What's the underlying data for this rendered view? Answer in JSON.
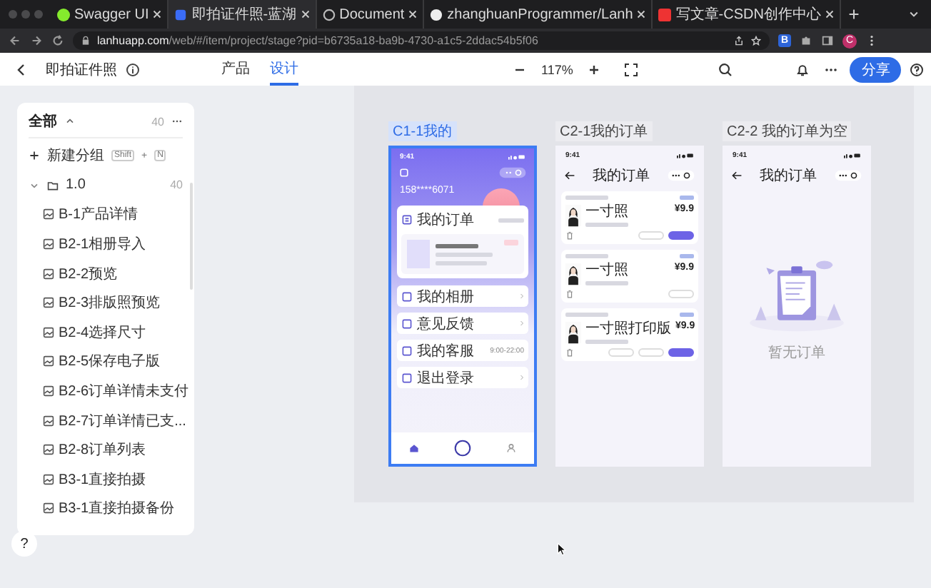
{
  "browser": {
    "tabs": [
      {
        "title": "Swagger UI",
        "selected": false,
        "kind": "swagger"
      },
      {
        "title": "即拍证件照-蓝湖",
        "selected": true,
        "kind": "lanhu"
      },
      {
        "title": "Document",
        "selected": false,
        "kind": "globe"
      },
      {
        "title": "zhanghuanProgrammer/Lanh",
        "selected": false,
        "kind": "github"
      },
      {
        "title": "写文章-CSDN创作中心",
        "selected": false,
        "kind": "csdn"
      }
    ],
    "url_host": "lanhuapp.com",
    "url_path": "/web/#/item/project/stage?pid=b6735a18-ba9b-4730-a1c5-2ddac54b5f06",
    "extension": "B",
    "profile": "C"
  },
  "header": {
    "project": "即拍证件照",
    "tabs": [
      {
        "label": "产品",
        "selected": false
      },
      {
        "label": "设计",
        "selected": true
      }
    ],
    "zoom": "117%",
    "share": "分享"
  },
  "sidebar": {
    "title": "全部",
    "count": "40",
    "new_group": "新建分组",
    "shortcut": [
      "Shift",
      "+",
      "N"
    ],
    "help": "?",
    "folders": [
      {
        "name": "1.0",
        "count": "40",
        "expanded": true,
        "children": [
          {
            "name": "B-1产品详情"
          },
          {
            "name": "B2-1相册导入"
          },
          {
            "name": "B2-2预览"
          },
          {
            "name": "B2-3排版照预览"
          },
          {
            "name": "B2-4选择尺寸"
          },
          {
            "name": "B2-5保存电子版"
          },
          {
            "name": "B2-6订单详情未支付"
          },
          {
            "name": "B2-7订单详情已支..."
          },
          {
            "name": "B2-8订单列表"
          },
          {
            "name": "B3-1直接拍摄"
          },
          {
            "name": "B3-1直接拍摄备份"
          }
        ]
      }
    ]
  },
  "boards": [
    {
      "kind": "profile",
      "title": "C1-1我的",
      "selected": true,
      "time": "9:41",
      "phone": "158****6071",
      "orders_title": "我的订单",
      "menu": [
        {
          "label": "我的相册"
        },
        {
          "label": "意见反馈"
        },
        {
          "label": "我的客服",
          "note": "9:00-22:00"
        },
        {
          "label": "退出登录"
        }
      ]
    },
    {
      "kind": "orders",
      "title": "C2-1我的订单",
      "selected": false,
      "time": "9:41",
      "page_title": "我的订单",
      "orders": [
        {
          "name": "一寸照",
          "price": "¥9.9",
          "buttons": [
            {
              "kind": "outline"
            },
            {
              "kind": "primary"
            }
          ]
        },
        {
          "name": "一寸照",
          "price": "¥9.9",
          "buttons": [
            {
              "kind": "outline"
            }
          ]
        },
        {
          "name": "一寸照打印版",
          "price": "¥9.9",
          "buttons": [
            {
              "kind": "outline"
            },
            {
              "kind": "outline"
            },
            {
              "kind": "primary"
            }
          ]
        }
      ]
    },
    {
      "kind": "empty",
      "title": "C2-2 我的订单为空",
      "selected": false,
      "time": "9:41",
      "page_title": "我的订单",
      "empty_text": "暂无订单"
    }
  ]
}
